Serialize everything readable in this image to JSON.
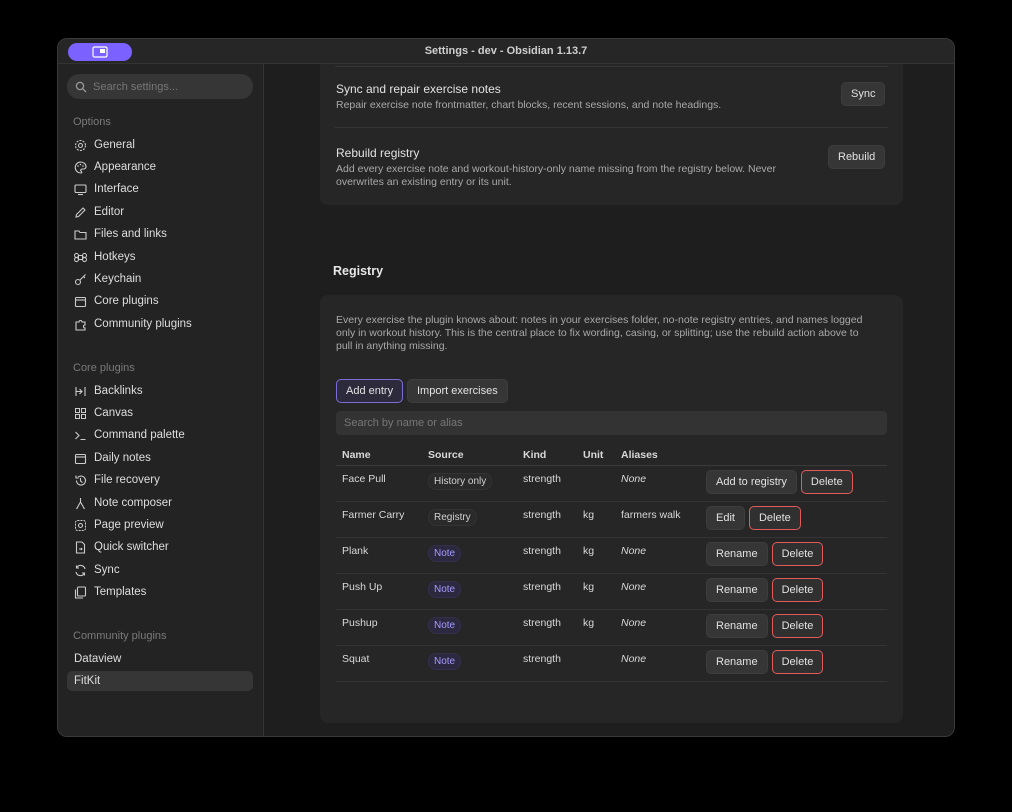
{
  "window": {
    "title": "Settings - dev - Obsidian 1.13.7"
  },
  "sidebar": {
    "search_placeholder": "Search settings...",
    "options_label": "Options",
    "options": [
      {
        "label": "General",
        "icon": "gear-icon"
      },
      {
        "label": "Appearance",
        "icon": "palette-icon"
      },
      {
        "label": "Interface",
        "icon": "monitor-icon"
      },
      {
        "label": "Editor",
        "icon": "pencil-icon"
      },
      {
        "label": "Files and links",
        "icon": "folder-icon"
      },
      {
        "label": "Hotkeys",
        "icon": "command-icon"
      },
      {
        "label": "Keychain",
        "icon": "key-icon"
      },
      {
        "label": "Core plugins",
        "icon": "calendar-icon"
      },
      {
        "label": "Community plugins",
        "icon": "puzzle-icon"
      }
    ],
    "core_plugins_label": "Core plugins",
    "core_plugins": [
      {
        "label": "Backlinks",
        "icon": "backlinks-icon"
      },
      {
        "label": "Canvas",
        "icon": "canvas-icon"
      },
      {
        "label": "Command palette",
        "icon": "terminal-icon"
      },
      {
        "label": "Daily notes",
        "icon": "calendar-icon"
      },
      {
        "label": "File recovery",
        "icon": "history-icon"
      },
      {
        "label": "Note composer",
        "icon": "merge-icon"
      },
      {
        "label": "Page preview",
        "icon": "preview-icon"
      },
      {
        "label": "Quick switcher",
        "icon": "file-icon"
      },
      {
        "label": "Sync",
        "icon": "sync-icon"
      },
      {
        "label": "Templates",
        "icon": "templates-icon"
      }
    ],
    "community_plugins_label": "Community plugins",
    "community_plugins": [
      {
        "label": "Dataview"
      },
      {
        "label": "FitKit",
        "active": true
      }
    ]
  },
  "settings": {
    "sync_title": "Sync and repair exercise notes",
    "sync_desc": "Repair exercise note frontmatter, chart blocks, recent sessions, and note headings.",
    "sync_button": "Sync",
    "rebuild_title": "Rebuild registry",
    "rebuild_desc_1": "Add every exercise note and workout-history-only name missing from the registry below. Never",
    "rebuild_desc_2": "overwrites an existing entry or its unit.",
    "rebuild_button": "Rebuild"
  },
  "registry": {
    "heading": "Registry",
    "desc_1": "Every exercise the plugin knows about: notes in your exercises folder, no-note registry entries, and names logged",
    "desc_2": "only in workout history. This is the central place to fix wording, casing, or splitting; use the rebuild action above to",
    "desc_3": "pull in anything missing.",
    "add_entry": "Add entry",
    "import_exercises": "Import exercises",
    "search_placeholder": "Search by name or alias",
    "columns": {
      "name": "Name",
      "source": "Source",
      "kind": "Kind",
      "unit": "Unit",
      "aliases": "Aliases"
    },
    "rows": [
      {
        "name": "Face Pull",
        "source": "History only",
        "kind": "strength",
        "unit": "",
        "aliases": "None",
        "action": "Add to registry",
        "delete": "Delete"
      },
      {
        "name": "Farmer Carry",
        "source": "Registry",
        "kind": "strength",
        "unit": "kg",
        "aliases": "farmers walk",
        "action": "Edit",
        "delete": "Delete"
      },
      {
        "name": "Plank",
        "source": "Note",
        "kind": "strength",
        "unit": "kg",
        "aliases": "None",
        "action": "Rename",
        "delete": "Delete"
      },
      {
        "name": "Push Up",
        "source": "Note",
        "kind": "strength",
        "unit": "kg",
        "aliases": "None",
        "action": "Rename",
        "delete": "Delete"
      },
      {
        "name": "Pushup",
        "source": "Note",
        "kind": "strength",
        "unit": "kg",
        "aliases": "None",
        "action": "Rename",
        "delete": "Delete"
      },
      {
        "name": "Squat",
        "source": "Note",
        "kind": "strength",
        "unit": "",
        "aliases": "None",
        "action": "Rename",
        "delete": "Delete"
      }
    ]
  },
  "colors": {
    "accent": "#7b61ff",
    "danger": "#e25b5b",
    "note_pill": "#a89cff"
  }
}
